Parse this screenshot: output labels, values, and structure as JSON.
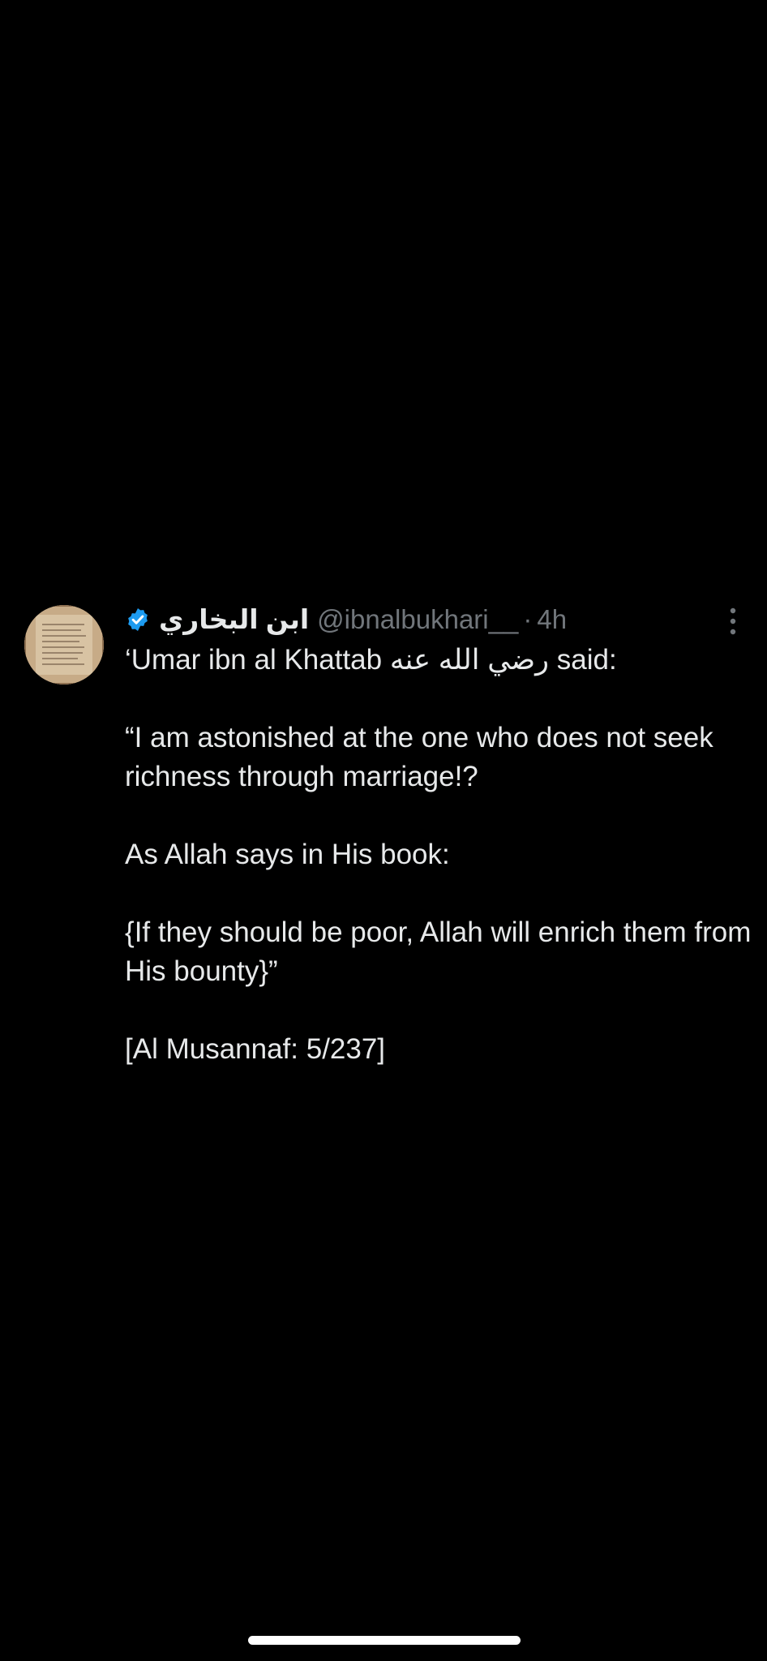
{
  "tweet": {
    "display_name": "ابن البخاري",
    "handle": "@ibnalbukhari__",
    "separator": "·",
    "time": "4h",
    "line1_prefix": "‘Umar ibn al Khattab ",
    "line1_arabic": "رضي الله عنه",
    "line1_suffix": " said:",
    "paragraph2": "“I am astonished at the one who does not seek richness through marriage!?",
    "paragraph3": "As Allah says in His book:",
    "paragraph4": "{If they should be poor, Allah will enrich them from His bounty}”",
    "paragraph5": "[Al Musannaf: 5/237]"
  },
  "icons": {
    "verified": "verified-badge-icon",
    "more": "more-vertical-icon"
  },
  "colors": {
    "background": "#000000",
    "text": "#e7e9ea",
    "secondary": "#71767b",
    "verified": "#1d9bf0"
  }
}
